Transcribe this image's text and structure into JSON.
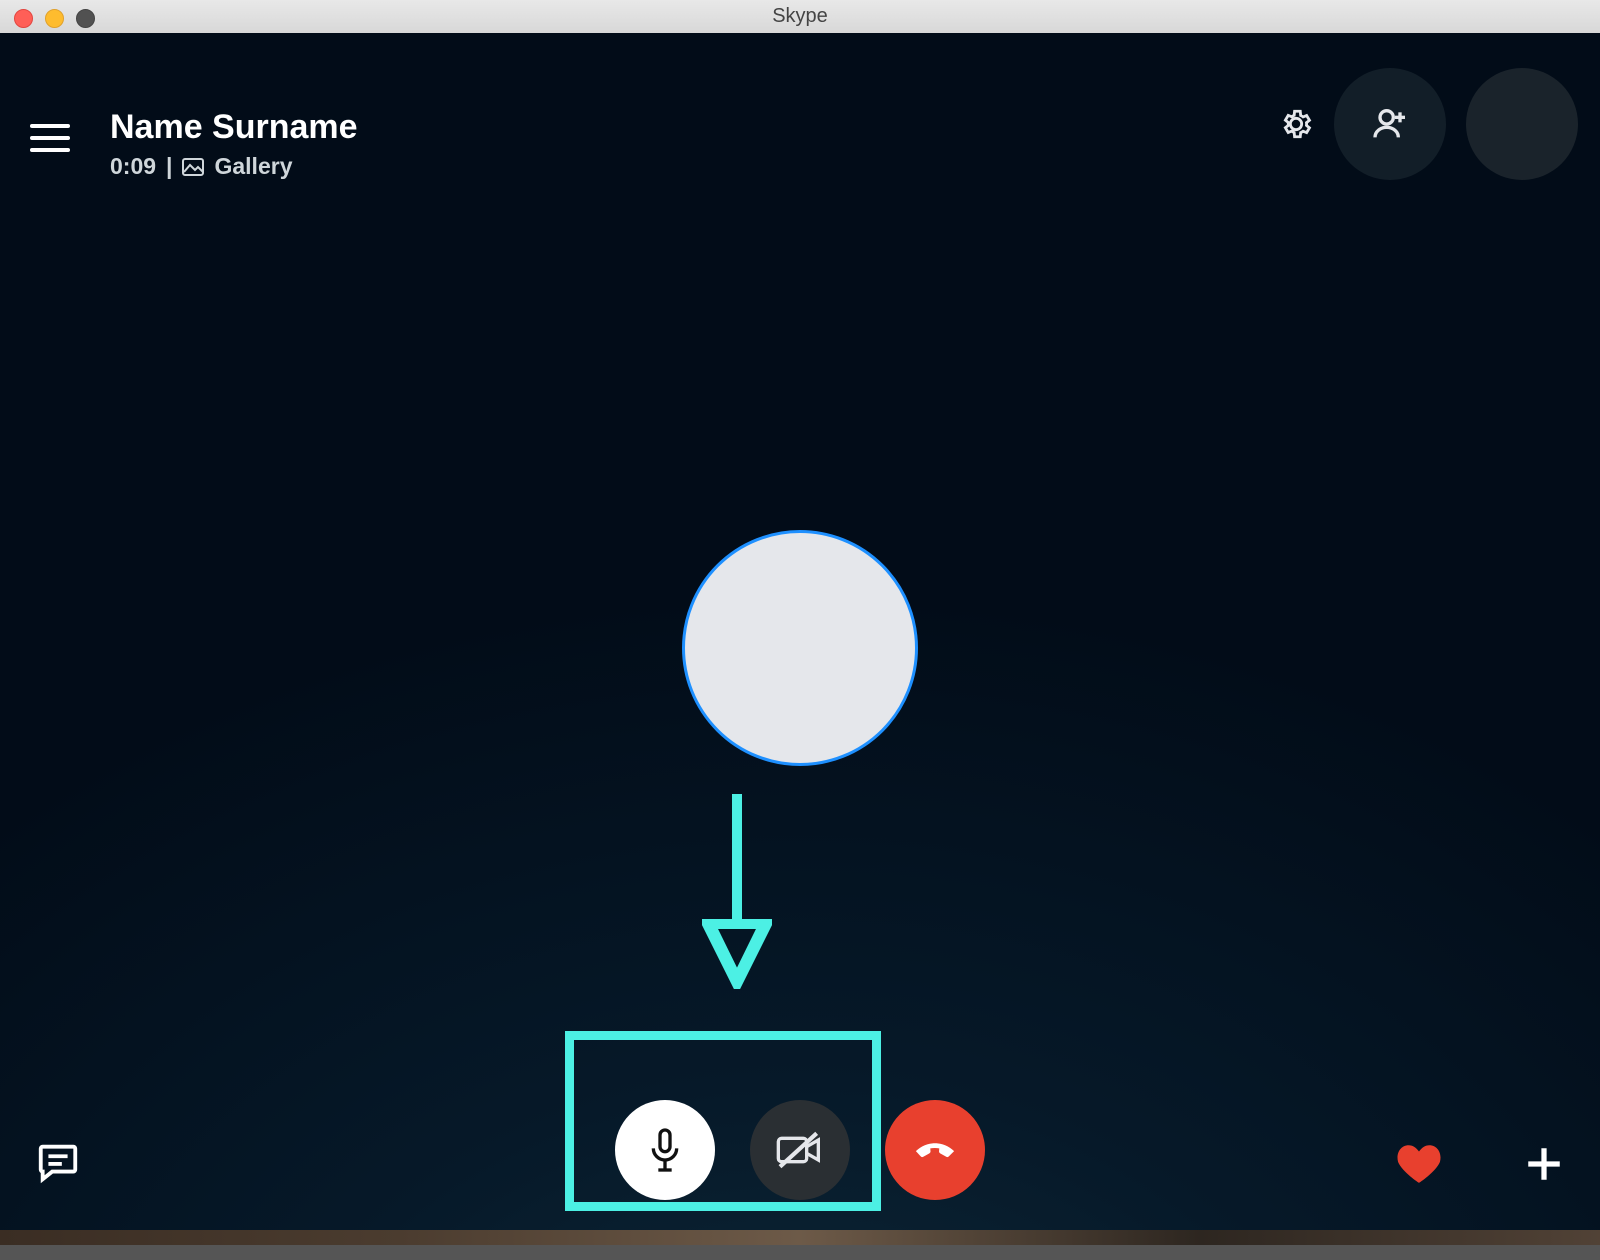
{
  "window": {
    "title": "Skype"
  },
  "header": {
    "contact_name": "Name Surname",
    "call_duration": "0:09",
    "separator": "|",
    "view_label": "Gallery"
  },
  "top_icons": {
    "menu": "hamburger-icon",
    "settings": "gear-icon",
    "add_participant": "add-person-icon",
    "self_avatar": "avatar-circle"
  },
  "call_controls": {
    "microphone": "microphone-icon",
    "camera": "camera-off-icon",
    "end_call": "hangup-icon"
  },
  "bottom_icons": {
    "chat": "chat-icon",
    "reaction": "heart-icon",
    "more": "plus-icon"
  },
  "annotation": {
    "highlight_color": "#4cf0e4"
  },
  "colors": {
    "end_call": "#e8402e",
    "background_top": "#020c18",
    "background_bottom": "#0f2a3a",
    "avatar_ring": "#1e90ff"
  }
}
